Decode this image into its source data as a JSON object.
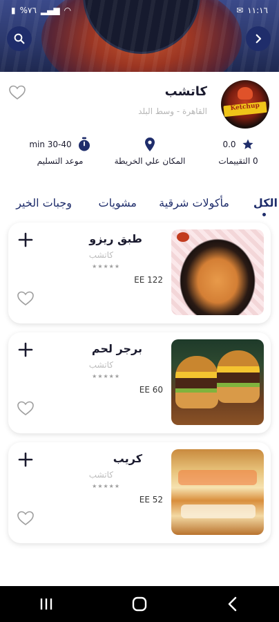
{
  "status_bar": {
    "time": "١١:١٦",
    "battery": "%٧٦"
  },
  "restaurant": {
    "name": "كاتشب",
    "location": "القاهرة - وسط البلد",
    "logo_text": "Ketchup",
    "rating_value": "0.0",
    "ratings_label": "0 التقييمات",
    "map_label": "المكان علي الخريطة",
    "delivery_time": "min 30-40",
    "delivery_label": "موعد التسليم"
  },
  "tabs": [
    {
      "label": "الكل",
      "active": true
    },
    {
      "label": "مأكولات شرقية",
      "active": false
    },
    {
      "label": "مشويات",
      "active": false
    },
    {
      "label": "وجبات الخير",
      "active": false
    }
  ],
  "products": [
    {
      "name": "طبق ريزو",
      "restaurant": "كاتشب",
      "price": "EE 122",
      "image": "pasta-dish"
    },
    {
      "name": "برجر لحم",
      "restaurant": "كاتشب",
      "price": "EE 60",
      "image": "beef-burger"
    },
    {
      "name": "كريب",
      "restaurant": "كاتشب",
      "price": "EE 52",
      "image": "crepe"
    }
  ],
  "colors": {
    "primary": "#1f2d6b",
    "text": "#1a1a2e",
    "muted": "#b5b5b5"
  },
  "icons": {
    "back": "chevron-right-icon",
    "search": "search-icon",
    "favorite": "heart-outline-icon",
    "rating": "star-icon",
    "map": "map-pin-icon",
    "time": "stopwatch-icon",
    "add": "plus-icon"
  }
}
